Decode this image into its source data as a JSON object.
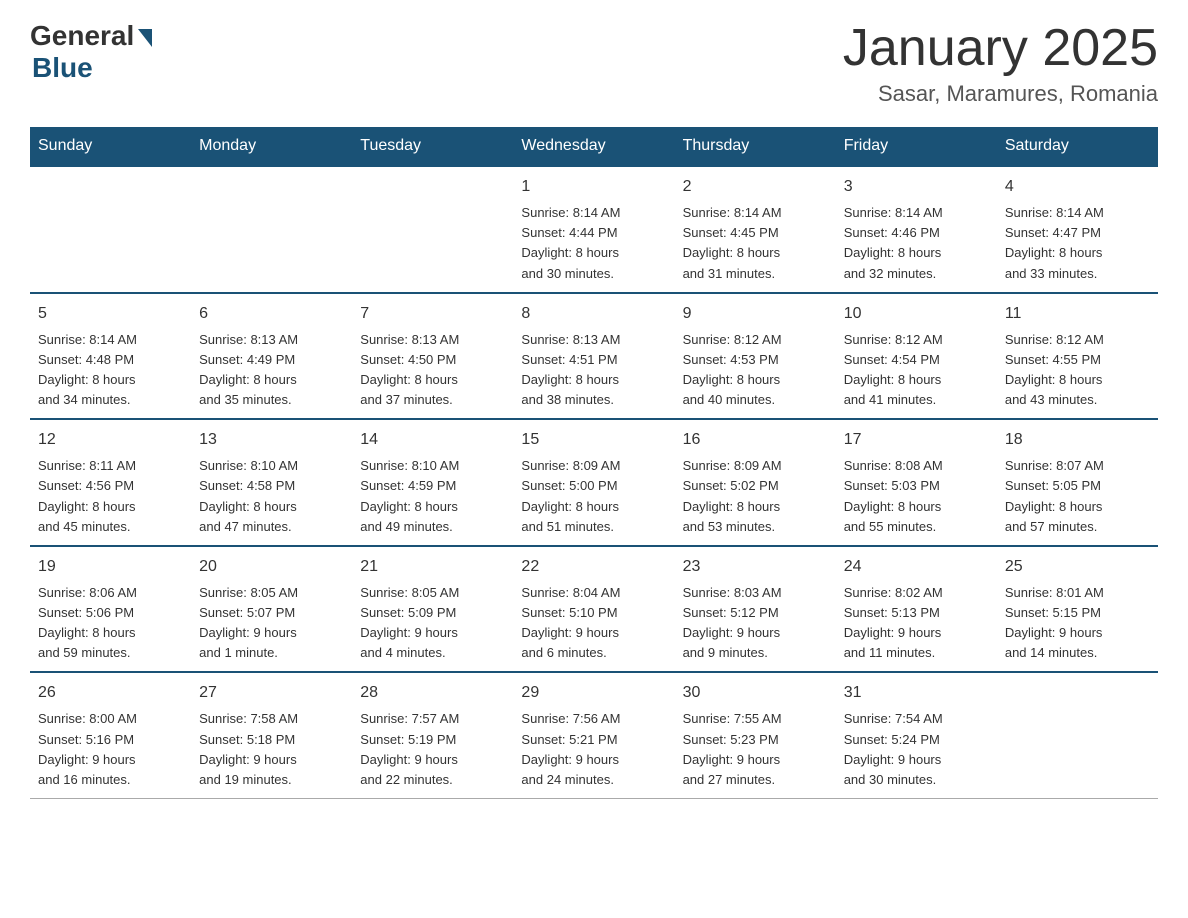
{
  "logo": {
    "general": "General",
    "blue": "Blue"
  },
  "header": {
    "title": "January 2025",
    "subtitle": "Sasar, Maramures, Romania"
  },
  "days_of_week": [
    "Sunday",
    "Monday",
    "Tuesday",
    "Wednesday",
    "Thursday",
    "Friday",
    "Saturday"
  ],
  "weeks": [
    [
      {
        "day": "",
        "info": ""
      },
      {
        "day": "",
        "info": ""
      },
      {
        "day": "",
        "info": ""
      },
      {
        "day": "1",
        "info": "Sunrise: 8:14 AM\nSunset: 4:44 PM\nDaylight: 8 hours\nand 30 minutes."
      },
      {
        "day": "2",
        "info": "Sunrise: 8:14 AM\nSunset: 4:45 PM\nDaylight: 8 hours\nand 31 minutes."
      },
      {
        "day": "3",
        "info": "Sunrise: 8:14 AM\nSunset: 4:46 PM\nDaylight: 8 hours\nand 32 minutes."
      },
      {
        "day": "4",
        "info": "Sunrise: 8:14 AM\nSunset: 4:47 PM\nDaylight: 8 hours\nand 33 minutes."
      }
    ],
    [
      {
        "day": "5",
        "info": "Sunrise: 8:14 AM\nSunset: 4:48 PM\nDaylight: 8 hours\nand 34 minutes."
      },
      {
        "day": "6",
        "info": "Sunrise: 8:13 AM\nSunset: 4:49 PM\nDaylight: 8 hours\nand 35 minutes."
      },
      {
        "day": "7",
        "info": "Sunrise: 8:13 AM\nSunset: 4:50 PM\nDaylight: 8 hours\nand 37 minutes."
      },
      {
        "day": "8",
        "info": "Sunrise: 8:13 AM\nSunset: 4:51 PM\nDaylight: 8 hours\nand 38 minutes."
      },
      {
        "day": "9",
        "info": "Sunrise: 8:12 AM\nSunset: 4:53 PM\nDaylight: 8 hours\nand 40 minutes."
      },
      {
        "day": "10",
        "info": "Sunrise: 8:12 AM\nSunset: 4:54 PM\nDaylight: 8 hours\nand 41 minutes."
      },
      {
        "day": "11",
        "info": "Sunrise: 8:12 AM\nSunset: 4:55 PM\nDaylight: 8 hours\nand 43 minutes."
      }
    ],
    [
      {
        "day": "12",
        "info": "Sunrise: 8:11 AM\nSunset: 4:56 PM\nDaylight: 8 hours\nand 45 minutes."
      },
      {
        "day": "13",
        "info": "Sunrise: 8:10 AM\nSunset: 4:58 PM\nDaylight: 8 hours\nand 47 minutes."
      },
      {
        "day": "14",
        "info": "Sunrise: 8:10 AM\nSunset: 4:59 PM\nDaylight: 8 hours\nand 49 minutes."
      },
      {
        "day": "15",
        "info": "Sunrise: 8:09 AM\nSunset: 5:00 PM\nDaylight: 8 hours\nand 51 minutes."
      },
      {
        "day": "16",
        "info": "Sunrise: 8:09 AM\nSunset: 5:02 PM\nDaylight: 8 hours\nand 53 minutes."
      },
      {
        "day": "17",
        "info": "Sunrise: 8:08 AM\nSunset: 5:03 PM\nDaylight: 8 hours\nand 55 minutes."
      },
      {
        "day": "18",
        "info": "Sunrise: 8:07 AM\nSunset: 5:05 PM\nDaylight: 8 hours\nand 57 minutes."
      }
    ],
    [
      {
        "day": "19",
        "info": "Sunrise: 8:06 AM\nSunset: 5:06 PM\nDaylight: 8 hours\nand 59 minutes."
      },
      {
        "day": "20",
        "info": "Sunrise: 8:05 AM\nSunset: 5:07 PM\nDaylight: 9 hours\nand 1 minute."
      },
      {
        "day": "21",
        "info": "Sunrise: 8:05 AM\nSunset: 5:09 PM\nDaylight: 9 hours\nand 4 minutes."
      },
      {
        "day": "22",
        "info": "Sunrise: 8:04 AM\nSunset: 5:10 PM\nDaylight: 9 hours\nand 6 minutes."
      },
      {
        "day": "23",
        "info": "Sunrise: 8:03 AM\nSunset: 5:12 PM\nDaylight: 9 hours\nand 9 minutes."
      },
      {
        "day": "24",
        "info": "Sunrise: 8:02 AM\nSunset: 5:13 PM\nDaylight: 9 hours\nand 11 minutes."
      },
      {
        "day": "25",
        "info": "Sunrise: 8:01 AM\nSunset: 5:15 PM\nDaylight: 9 hours\nand 14 minutes."
      }
    ],
    [
      {
        "day": "26",
        "info": "Sunrise: 8:00 AM\nSunset: 5:16 PM\nDaylight: 9 hours\nand 16 minutes."
      },
      {
        "day": "27",
        "info": "Sunrise: 7:58 AM\nSunset: 5:18 PM\nDaylight: 9 hours\nand 19 minutes."
      },
      {
        "day": "28",
        "info": "Sunrise: 7:57 AM\nSunset: 5:19 PM\nDaylight: 9 hours\nand 22 minutes."
      },
      {
        "day": "29",
        "info": "Sunrise: 7:56 AM\nSunset: 5:21 PM\nDaylight: 9 hours\nand 24 minutes."
      },
      {
        "day": "30",
        "info": "Sunrise: 7:55 AM\nSunset: 5:23 PM\nDaylight: 9 hours\nand 27 minutes."
      },
      {
        "day": "31",
        "info": "Sunrise: 7:54 AM\nSunset: 5:24 PM\nDaylight: 9 hours\nand 30 minutes."
      },
      {
        "day": "",
        "info": ""
      }
    ]
  ]
}
